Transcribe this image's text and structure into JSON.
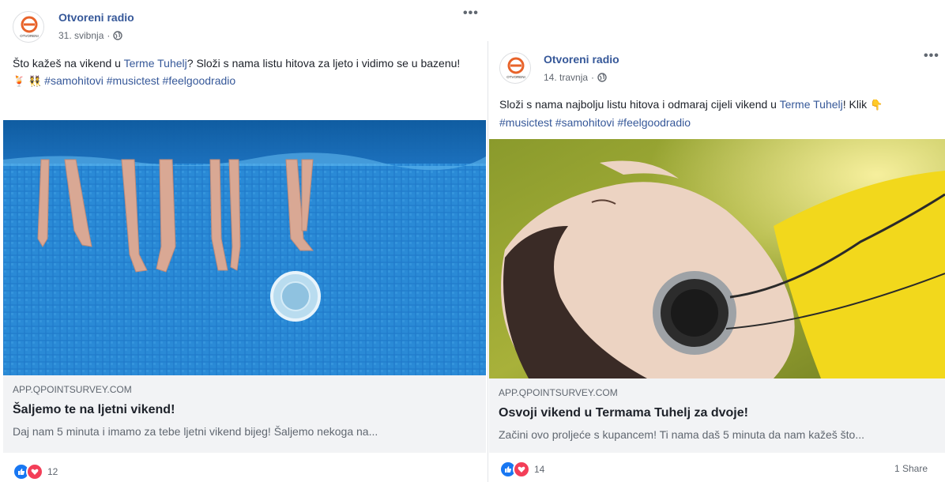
{
  "posts": [
    {
      "page_name": "Otvoreni radio",
      "date": "31. svibnja",
      "more": "•••",
      "text_before": "Što kažeš na vikend u ",
      "link": "Terme Tuhelj",
      "text_after": "? Složi s nama listu hitova za ljeto i vidimo se u bazenu! ",
      "emoji": [
        "🍹",
        "👯"
      ],
      "hashtags": "#samohitovi #musictest #feelgoodradio",
      "domain": "APP.QPOINTSURVEY.COM",
      "title": "Šaljemo te na ljetni vikend!",
      "desc": "Daj nam 5 minuta i imamo za tebe ljetni vikend bijeg! Šaljemo nekoga na...",
      "reactions_count": "12",
      "shares": ""
    },
    {
      "page_name": "Otvoreni radio",
      "date": "14. travnja",
      "more": "•••",
      "text_before": "Složi s nama najbolju listu hitova i odmaraj cijeli vikend u ",
      "link": "Terme Tuhelj",
      "text_after": "! Klik ",
      "emoji": [
        "👇"
      ],
      "hashtags": "#musictest #samohitovi #feelgoodradio",
      "domain": "APP.QPOINTSURVEY.COM",
      "title": "Osvoji vikend u Termama Tuhelj za dvoje!",
      "desc": "Začini ovo proljeće s kupancem! Ti nama daš 5 minuta da nam kažeš što...",
      "reactions_count": "14",
      "shares": "1 Share"
    }
  ],
  "avatar_caption": "OTVORENI",
  "colors": {
    "link": "#365899",
    "like": "#1877f2",
    "love": "#f33e58",
    "brand_orange": "#e8632a"
  }
}
